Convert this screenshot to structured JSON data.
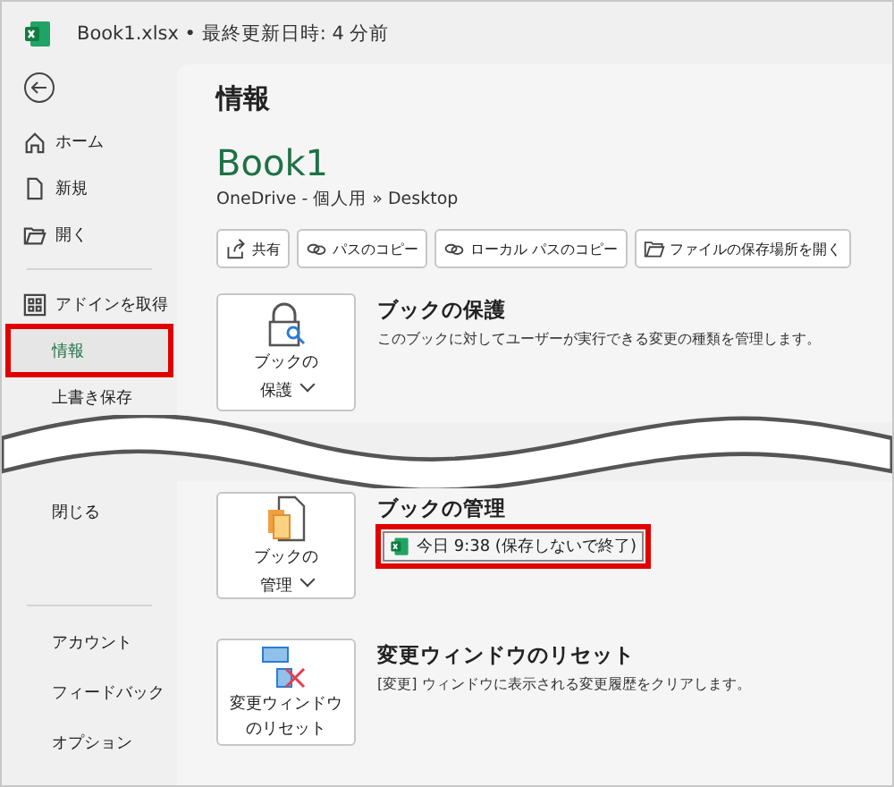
{
  "title_bar": {
    "title": "Book1.xlsx • 最終更新日時: 4 分前"
  },
  "sidebar": {
    "top_items": [
      {
        "label": "ホーム",
        "selected": false,
        "highlighted": false
      },
      {
        "label": "新規",
        "selected": false,
        "highlighted": false
      },
      {
        "label": "開く",
        "selected": false,
        "highlighted": false
      },
      {
        "kind": "divider"
      },
      {
        "label": "アドインを取得",
        "selected": false,
        "highlighted": false
      },
      {
        "label": "情報",
        "selected": true,
        "highlighted": true
      },
      {
        "label": "上書き保存",
        "selected": false,
        "highlighted": false
      }
    ],
    "bottom_items": [
      {
        "label": "閉じる",
        "selected": false,
        "highlighted": false
      }
    ],
    "footer_items": [
      {
        "label": "アカウント"
      },
      {
        "label": "フィードバック"
      },
      {
        "label": "オプション"
      }
    ]
  },
  "main": {
    "heading": "情報",
    "file_name": "Book1",
    "path": "OneDrive - 個人用 » Desktop",
    "actions": [
      {
        "label": "共有"
      },
      {
        "label": "パスのコピー"
      },
      {
        "label": "ローカル パスのコピー"
      },
      {
        "label": "ファイルの保存場所を開く"
      }
    ],
    "sections": [
      {
        "button_lines": [
          "ブックの",
          "保護"
        ],
        "dropdown": true,
        "title": "ブックの保護",
        "description": "このブックに対してユーザーが実行できる変更の種類を管理します。"
      }
    ],
    "sections_below": [
      {
        "button_lines": [
          "ブックの",
          "管理"
        ],
        "dropdown": true,
        "title": "ブックの管理",
        "version": {
          "label": "今日 9:38 (保存しないで終了)",
          "highlighted": true
        }
      },
      {
        "button_lines": [
          "変更ウィンドウ",
          "のリセット"
        ],
        "title": "変更ウィンドウのリセット",
        "description": "[変更] ウィンドウに表示される変更履歴をクリアします。"
      }
    ]
  }
}
